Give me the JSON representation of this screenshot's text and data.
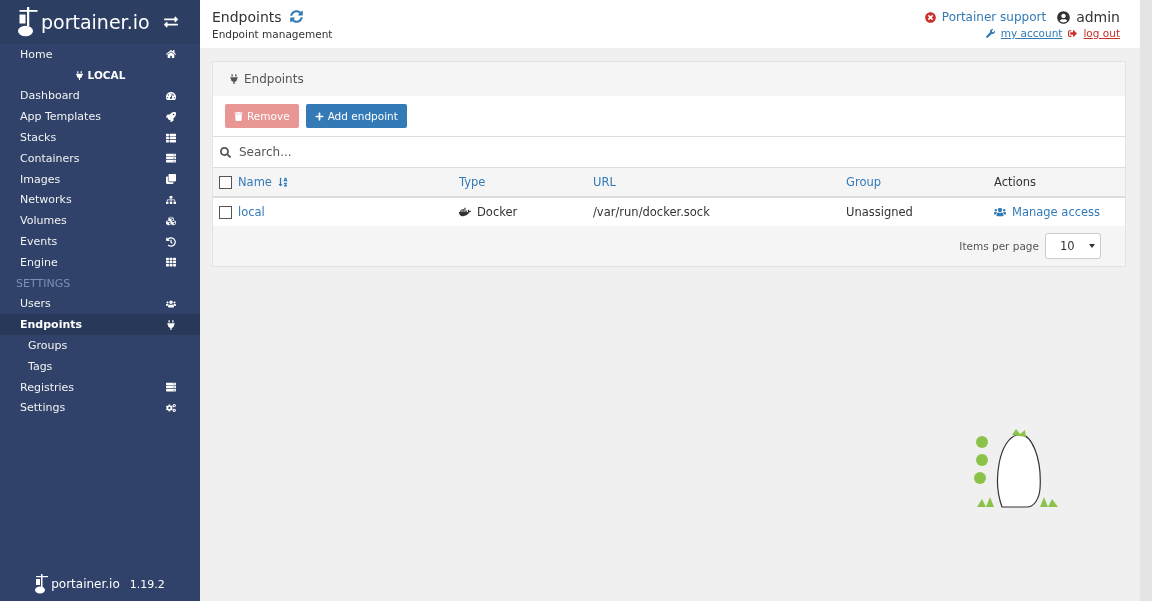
{
  "sidebar": {
    "brand": "portainer.io",
    "items": [
      {
        "kind": "item",
        "label": "Home",
        "selected": false
      },
      {
        "kind": "endpoint",
        "label": "LOCAL"
      },
      {
        "kind": "item",
        "label": "Dashboard",
        "selected": false
      },
      {
        "kind": "item",
        "label": "App Templates",
        "selected": false
      },
      {
        "kind": "item",
        "label": "Stacks",
        "selected": false
      },
      {
        "kind": "item",
        "label": "Containers",
        "selected": false
      },
      {
        "kind": "item",
        "label": "Images",
        "selected": false
      },
      {
        "kind": "item",
        "label": "Networks",
        "selected": false
      },
      {
        "kind": "item",
        "label": "Volumes",
        "selected": false
      },
      {
        "kind": "item",
        "label": "Events",
        "selected": false
      },
      {
        "kind": "item",
        "label": "Engine",
        "selected": false
      },
      {
        "kind": "section",
        "label": "SETTINGS"
      },
      {
        "kind": "item",
        "label": "Users",
        "selected": false
      },
      {
        "kind": "item",
        "label": "Endpoints",
        "selected": true
      },
      {
        "kind": "subitem",
        "label": "Groups",
        "selected": false
      },
      {
        "kind": "subitem",
        "label": "Tags",
        "selected": false
      },
      {
        "kind": "item",
        "label": "Registries",
        "selected": false
      },
      {
        "kind": "item",
        "label": "Settings",
        "selected": false
      }
    ],
    "footer": {
      "brand": "portainer.io",
      "version": "1.19.2"
    }
  },
  "header": {
    "title": "Endpoints",
    "subtitle": "Endpoint management",
    "support": "Portainer support",
    "user": "admin",
    "my_account": "my account",
    "log_out": "log out"
  },
  "panel": {
    "title": "Endpoints",
    "buttons": [
      {
        "label": "Remove",
        "disabled": true
      },
      {
        "label": "Add endpoint",
        "disabled": false
      }
    ],
    "search": {
      "placeholder": "Search..."
    },
    "select_all_checked": false,
    "columns": [
      "Name",
      "Type",
      "URL",
      "Group",
      "Actions"
    ],
    "rows": [
      {
        "checked": false,
        "name": "local",
        "type": "Docker",
        "url": "/var/run/docker.sock",
        "group": "Unassigned",
        "action": "Manage access"
      }
    ],
    "items_per_page_label": "Items per page",
    "items_per_page": "10"
  }
}
